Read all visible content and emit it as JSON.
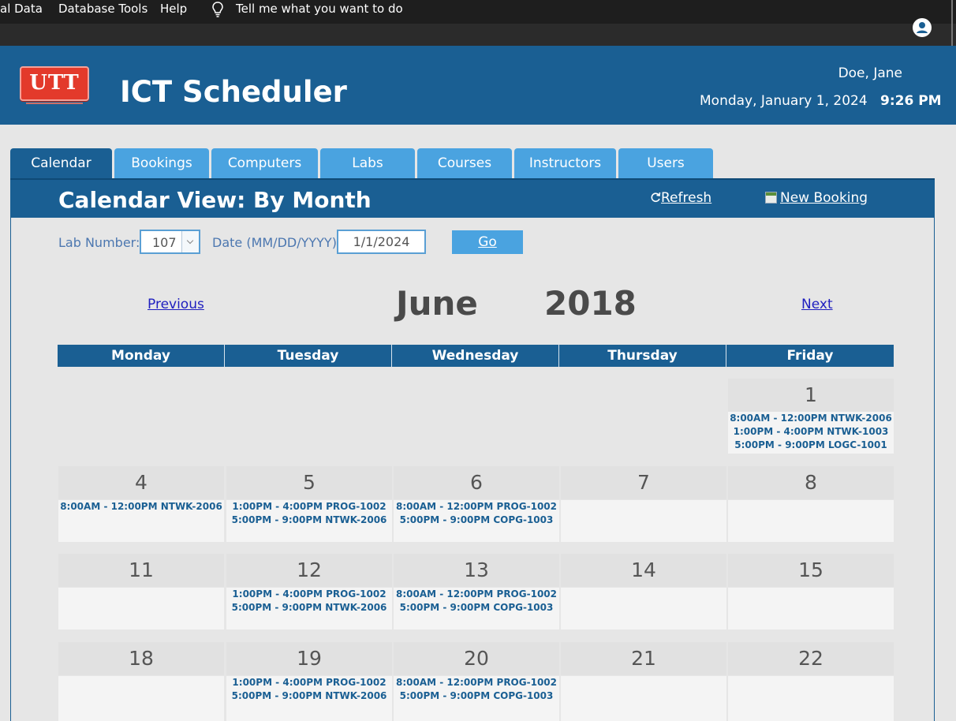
{
  "ribbon": {
    "items": [
      "al Data",
      "Database Tools",
      "Help"
    ],
    "tell_me": "Tell me what you want to do"
  },
  "header": {
    "logo_text": "UTT",
    "app_title": "ICT Scheduler",
    "user_name": "Doe, Jane",
    "date": "Monday, January 1, 2024",
    "time": "9:26 PM"
  },
  "tabs": [
    "Calendar",
    "Bookings",
    "Computers",
    "Labs",
    "Courses",
    "Instructors",
    "Users"
  ],
  "panel": {
    "title": "Calendar View: By Month",
    "refresh_label": "Refresh",
    "new_booking_label": "New Booking"
  },
  "filters": {
    "lab_label": "Lab Number:",
    "lab_value": "107",
    "date_label": "Date (MM/DD/YYYY)",
    "date_value": "1/1/2024",
    "go_label": "Go"
  },
  "month_nav": {
    "previous": "Previous",
    "next": "Next",
    "month": "June",
    "year": "2018"
  },
  "weekdays": [
    "Monday",
    "Tuesday",
    "Wednesday",
    "Thursday",
    "Friday"
  ],
  "weeks": [
    [
      {
        "day": "",
        "events": []
      },
      {
        "day": "",
        "events": []
      },
      {
        "day": "",
        "events": []
      },
      {
        "day": "",
        "events": []
      },
      {
        "day": "1",
        "events": [
          "8:00AM - 12:00PM NTWK-2006",
          "1:00PM - 4:00PM NTWK-1003",
          "5:00PM - 9:00PM LOGC-1001"
        ]
      }
    ],
    [
      {
        "day": "4",
        "events": [
          "8:00AM - 12:00PM NTWK-2006"
        ]
      },
      {
        "day": "5",
        "events": [
          "1:00PM - 4:00PM PROG-1002",
          "5:00PM - 9:00PM NTWK-2006"
        ]
      },
      {
        "day": "6",
        "events": [
          "8:00AM - 12:00PM PROG-1002",
          "5:00PM - 9:00PM COPG-1003"
        ]
      },
      {
        "day": "7",
        "events": []
      },
      {
        "day": "8",
        "events": []
      }
    ],
    [
      {
        "day": "11",
        "events": []
      },
      {
        "day": "12",
        "events": [
          "1:00PM - 4:00PM PROG-1002",
          "5:00PM - 9:00PM NTWK-2006"
        ]
      },
      {
        "day": "13",
        "events": [
          "8:00AM - 12:00PM PROG-1002",
          "5:00PM - 9:00PM COPG-1003"
        ]
      },
      {
        "day": "14",
        "events": []
      },
      {
        "day": "15",
        "events": []
      }
    ],
    [
      {
        "day": "18",
        "events": []
      },
      {
        "day": "19",
        "events": [
          "1:00PM - 4:00PM PROG-1002",
          "5:00PM - 9:00PM NTWK-2006"
        ]
      },
      {
        "day": "20",
        "events": [
          "8:00AM - 12:00PM PROG-1002",
          "5:00PM - 9:00PM COPG-1003"
        ]
      },
      {
        "day": "21",
        "events": []
      },
      {
        "day": "22",
        "events": []
      }
    ]
  ]
}
